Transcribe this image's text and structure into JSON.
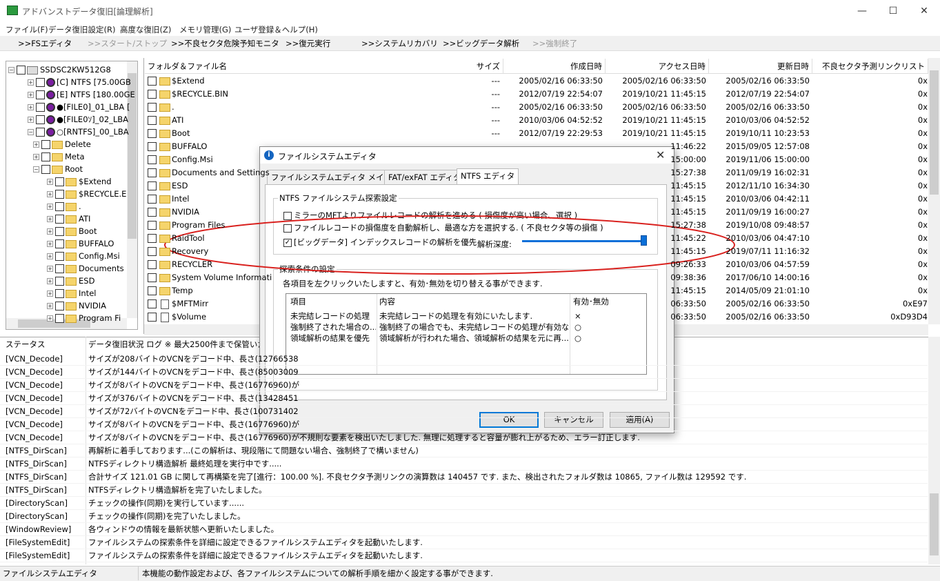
{
  "window": {
    "title": "アドバンストデータ復旧[論理解析]",
    "minimize": "—",
    "maximize": "☐",
    "close": "✕"
  },
  "menu": [
    "ファイル(F)",
    "データ復旧設定(R)",
    "高度な復旧(Z)",
    "メモリ管理(G)",
    "ユーザ登録＆ヘルプ(H)"
  ],
  "toolbar": [
    {
      "label": ">>FSエディタ",
      "enabled": true
    },
    {
      "label": ">>スタート/ストップ",
      "enabled": false
    },
    {
      "label": ">>不良セクタ危険予知モニタ",
      "enabled": true
    },
    {
      "label": ">>復元実行",
      "enabled": true
    },
    {
      "label": ">>システムリカバリ",
      "enabled": true
    },
    {
      "label": ">>ビッグデータ解析",
      "enabled": true
    },
    {
      "label": ">>強制終了",
      "enabled": false
    }
  ],
  "tree": [
    {
      "label": "SSDSC2KW512G8",
      "type": "drive",
      "level": 0
    },
    {
      "label": "[C] NTFS [75.00GB",
      "type": "disk",
      "level": 1
    },
    {
      "label": "[E] NTFS [180.00GE",
      "type": "disk",
      "level": 1
    },
    {
      "label": "●[FILE0]_01_LBA [",
      "type": "disk",
      "level": 1
    },
    {
      "label": "●[FILE0ｿ]_02_LBA",
      "type": "disk",
      "level": 1
    },
    {
      "label": "○[RNTFS]_00_LBA",
      "type": "disk",
      "level": 1
    },
    {
      "label": "Delete",
      "type": "folder",
      "level": 2
    },
    {
      "label": "Meta",
      "type": "folder",
      "level": 2
    },
    {
      "label": "Root",
      "type": "folder",
      "level": 2
    },
    {
      "label": "$Extend",
      "type": "folder",
      "level": 3
    },
    {
      "label": "$RECYCLE.E",
      "type": "folder",
      "level": 3
    },
    {
      "label": ".",
      "type": "folder",
      "level": 3
    },
    {
      "label": "ATI",
      "type": "folder",
      "level": 3
    },
    {
      "label": "Boot",
      "type": "folder",
      "level": 3
    },
    {
      "label": "BUFFALO",
      "type": "folder",
      "level": 3
    },
    {
      "label": "Config.Msi",
      "type": "folder",
      "level": 3
    },
    {
      "label": "Documents",
      "type": "folder",
      "level": 3
    },
    {
      "label": "ESD",
      "type": "folder",
      "level": 3
    },
    {
      "label": "Intel",
      "type": "folder",
      "level": 3
    },
    {
      "label": "NVIDIA",
      "type": "folder",
      "level": 3
    },
    {
      "label": "Program Fi",
      "type": "folder",
      "level": 3
    }
  ],
  "filelist": {
    "columns": [
      "フォルダ＆ファイル名",
      "サイズ",
      "作成日時",
      "アクセス日時",
      "更新日時",
      "不良セクタ予測リンクリスト"
    ],
    "rows": [
      {
        "name": "$Extend",
        "size": "---",
        "created": "2005/02/16 06:33:50",
        "accessed": "2005/02/16 06:33:50",
        "modified": "2005/02/16 06:33:50",
        "link": "0x",
        "icon": "folder"
      },
      {
        "name": "$RECYCLE.BIN",
        "size": "---",
        "created": "2012/07/19 22:54:07",
        "accessed": "2019/10/21 11:45:15",
        "modified": "2012/07/19 22:54:07",
        "link": "0x",
        "icon": "folder"
      },
      {
        "name": ".",
        "size": "---",
        "created": "2005/02/16 06:33:50",
        "accessed": "2005/02/16 06:33:50",
        "modified": "2005/02/16 06:33:50",
        "link": "0x",
        "icon": "folder"
      },
      {
        "name": "ATI",
        "size": "---",
        "created": "2010/03/06 04:52:52",
        "accessed": "2019/10/21 11:45:15",
        "modified": "2010/03/06 04:52:52",
        "link": "0x",
        "icon": "folder"
      },
      {
        "name": "Boot",
        "size": "---",
        "created": "2012/07/19 22:29:53",
        "accessed": "2019/10/21 11:45:15",
        "modified": "2019/10/11 10:23:53",
        "link": "0x",
        "icon": "folder"
      },
      {
        "name": "BUFFALO",
        "size": "",
        "created": "",
        "accessed": "11:46:22",
        "modified": "2015/09/05 12:57:08",
        "link": "0x",
        "icon": "folder"
      },
      {
        "name": "Config.Msi",
        "size": "",
        "created": "",
        "accessed": "15:00:00",
        "modified": "2019/11/06 15:00:00",
        "link": "0x",
        "icon": "folder"
      },
      {
        "name": "Documents and Settings",
        "size": "",
        "created": "",
        "accessed": "15:27:38",
        "modified": "2011/09/19 16:02:31",
        "link": "0x",
        "icon": "folder"
      },
      {
        "name": "ESD",
        "size": "",
        "created": "",
        "accessed": "11:45:15",
        "modified": "2012/11/10 16:34:30",
        "link": "0x",
        "icon": "folder"
      },
      {
        "name": "Intel",
        "size": "",
        "created": "",
        "accessed": "11:45:15",
        "modified": "2010/03/06 04:42:11",
        "link": "0x",
        "icon": "folder"
      },
      {
        "name": "NVIDIA",
        "size": "",
        "created": "",
        "accessed": "11:45:15",
        "modified": "2011/09/19 16:00:27",
        "link": "0x",
        "icon": "folder"
      },
      {
        "name": "Program Files",
        "size": "",
        "created": "",
        "accessed": "15:27:38",
        "modified": "2019/10/08 09:48:57",
        "link": "0x",
        "icon": "folder"
      },
      {
        "name": "RaidTool",
        "size": "",
        "created": "",
        "accessed": "11:45:22",
        "modified": "2010/03/06 04:47:10",
        "link": "0x",
        "icon": "folder"
      },
      {
        "name": "Recovery",
        "size": "",
        "created": "",
        "accessed": "11:45:15",
        "modified": "2019/07/11 11:16:32",
        "link": "0x",
        "icon": "folder"
      },
      {
        "name": "RECYCLER",
        "size": "",
        "created": "",
        "accessed": "09:26:33",
        "modified": "2010/03/06 04:57:59",
        "link": "0x",
        "icon": "folder"
      },
      {
        "name": "System Volume Informati",
        "size": "",
        "created": "",
        "accessed": "09:38:36",
        "modified": "2017/06/10 14:00:16",
        "link": "0x",
        "icon": "folder"
      },
      {
        "name": "Temp",
        "size": "",
        "created": "",
        "accessed": "11:45:15",
        "modified": "2014/05/09 21:01:10",
        "link": "0x",
        "icon": "folder"
      },
      {
        "name": "$MFTMirr",
        "size": "",
        "created": "",
        "accessed": "06:33:50",
        "modified": "2005/02/16 06:33:50",
        "link": "0xE97",
        "icon": "file"
      },
      {
        "name": "$Volume",
        "size": "",
        "created": "",
        "accessed": "06:33:50",
        "modified": "2005/02/16 06:33:50",
        "link": "0xD93D4",
        "icon": "file"
      }
    ]
  },
  "log": {
    "columns": [
      "ステータス",
      "データ復旧状況 ログ ※ 最大2500件まで保管いたしま"
    ],
    "rows": [
      {
        "status": "[VCN_Decode]",
        "msg": "サイズが208バイトのVCNをデコード中、長さ(12766538"
      },
      {
        "status": "[VCN_Decode]",
        "msg": "サイズが144バイトのVCNをデコード中、長さ(85003009"
      },
      {
        "status": "[VCN_Decode]",
        "msg": "サイズが8バイトのVCNをデコード中、長さ(16776960)が"
      },
      {
        "status": "[VCN_Decode]",
        "msg": "サイズが376バイトのVCNをデコード中、長さ(13428451"
      },
      {
        "status": "[VCN_Decode]",
        "msg": "サイズが72バイトのVCNをデコード中、長さ(100731402"
      },
      {
        "status": "[VCN_Decode]",
        "msg": "サイズが8バイトのVCNをデコード中、長さ(16776960)が"
      },
      {
        "status": "[VCN_Decode]",
        "msg": "サイズが8バイトのVCNをデコード中、長さ(16776960)が不規則な要素を検出いたしました. 無理に処理すると容量が膨れ上がるため、エラー訂正します."
      },
      {
        "status": "[NTFS_DirScan]",
        "msg": "再解析に着手しております...(この解析は、現段階にて問題ない場合、強制終了で構いません)"
      },
      {
        "status": "[NTFS_DirScan]",
        "msg": "NTFSディレクトリ構造解析 最終処理を実行中です....."
      },
      {
        "status": "[NTFS_DirScan]",
        "msg": "合計サイズ 121.01 GB に関して再構築を完了[進行：100.00 %]. 不良セクタ予測リンクの演算数は 140457 です. また、検出されたフォルダ数は 10865, ファイル数は 129592 です."
      },
      {
        "status": "[NTFS_DirScan]",
        "msg": "NTFSディレクトリ構造解析を完了いたしました。"
      },
      {
        "status": "[DirectoryScan]",
        "msg": "チェックの操作(同期)を実行しています......"
      },
      {
        "status": "[DirectoryScan]",
        "msg": "チェックの操作(同期)を完了いたしました。"
      },
      {
        "status": "[WindowReview]",
        "msg": "各ウィンドウの情報を最新状態へ更新いたしました。"
      },
      {
        "status": "[FileSystemEdit]",
        "msg": "ファイルシステムの探索条件を詳細に設定できるファイルシステムエディタを起動いたします."
      },
      {
        "status": "[FileSystemEdit]",
        "msg": "ファイルシステムの探索条件を詳細に設定できるファイルシステムエディタを起動いたします."
      }
    ]
  },
  "statusbar": {
    "left": "ファイルシステムエディタ",
    "right": "本機能の動作設定および、各ファイルシステムについての解析手順を細かく設定する事ができます."
  },
  "dialog": {
    "title": "ファイルシステムエディタ",
    "close": "✕",
    "tabs": [
      "ファイルシステムエディタ メイン設定",
      "FAT/exFAT エディタ",
      "NTFS エディタ"
    ],
    "group1_title": "NTFS ファイルシステム探索設定",
    "options": [
      {
        "label": "ミラーのMFTよりファイルレコードの解析を進める ( 損傷度が高い場合、選択 )",
        "checked": false
      },
      {
        "label": "ファイルレコードの損傷度を自動解析し、最適な方を選択する. ( 不良セクタ等の損傷 )",
        "checked": false
      },
      {
        "label": "[ビッグデータ] インデックスレコードの解析を優先",
        "checked": true
      }
    ],
    "depth_label": "解析深度:",
    "depth_level": 1.0,
    "group2_title": "探索条件の設定",
    "group2_desc": "各項目を左クリックいたしますと、有効･無効を切り替える事ができます.",
    "table": {
      "columns": [
        "項目",
        "内容",
        "有効･無効"
      ],
      "rows": [
        {
          "item": "未完結レコードの処理",
          "content": "未完結レコードの処理を有効にいたします.",
          "state": "×"
        },
        {
          "item": "強制終了された場合の...",
          "content": "強制終了の場合でも、未完結レコードの処理が有効な...",
          "state": "○"
        },
        {
          "item": "領域解析の結果を優先",
          "content": "領域解析が行われた場合、領域解析の結果を元に再...",
          "state": "○"
        }
      ]
    },
    "buttons": {
      "ok": "OK",
      "cancel": "キャンセル",
      "apply": "適用(A)"
    }
  },
  "colors": {
    "highlight": "#d9211e",
    "accent": "#0078d7"
  }
}
